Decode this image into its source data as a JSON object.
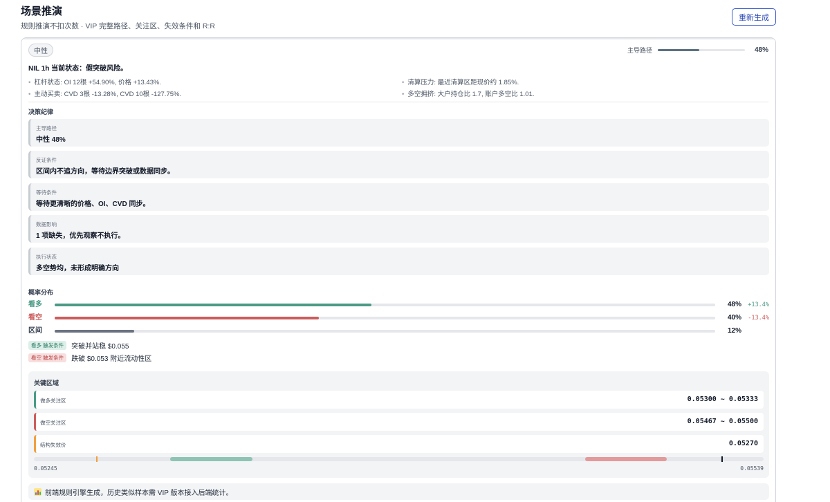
{
  "header": {
    "title": "场景推演",
    "subtitle": "规则推演不扣次数 · VIP 完整路径、关注区、失效条件和 R:R",
    "regenerate_label": "重新生成"
  },
  "summary": {
    "stance": "中性",
    "main_path_label": "主导路径",
    "main_path_pct": "48%",
    "main_path_value": 0.48,
    "status": "NIL 1h 当前状态：假突破风险。",
    "metrics": [
      "杠杆状态: OI 12根 +54.90%, 价格 +13.43%.",
      "清算压力: 最近清算区距现价约 1.85%.",
      "主动买卖: CVD 3根 -13.28%, CVD 10根 -127.75%.",
      "多空拥挤: 大户持仓比 1.7, 账户多空比 1.01."
    ]
  },
  "discipline": {
    "title": "决策纪律",
    "items": [
      {
        "label": "主导路径",
        "value": "中性 48%"
      },
      {
        "label": "反证条件",
        "value": "区间内不追方向，等待边界突破或数据同步。"
      },
      {
        "label": "等待条件",
        "value": "等待更清晰的价格、OI、CVD 同步。"
      },
      {
        "label": "数据影响",
        "value": "1 项缺失，优先观察不执行。"
      },
      {
        "label": "执行状态",
        "value": "多空势均，未形成明确方向"
      }
    ]
  },
  "probability": {
    "title": "概率分布",
    "rows": [
      {
        "label": "看多",
        "pct": "48%",
        "value": 0.48,
        "change": "+13.4%",
        "color": "#4a9a84"
      },
      {
        "label": "看空",
        "pct": "40%",
        "value": 0.4,
        "change": "-13.4%",
        "color": "#cc5c5c"
      },
      {
        "label": "区间",
        "pct": "12%",
        "value": 0.12,
        "change": "",
        "color": "#6b7280"
      }
    ],
    "triggers": [
      {
        "tag": "看多 触发条件",
        "text": "突破并站稳 $0.055"
      },
      {
        "tag": "看空 触发条件",
        "text": "跌破 $0.053 附近流动性区"
      }
    ]
  },
  "zones": {
    "title": "关键区域",
    "items": [
      {
        "label": "做多关注区",
        "value": "0.05300 ~ 0.05333",
        "color": "#4a9a84"
      },
      {
        "label": "做空关注区",
        "value": "0.05467 ~ 0.05500",
        "color": "#cc5c5c"
      },
      {
        "label": "结构失效价",
        "value": "0.05270",
        "color": "#f0a040"
      }
    ],
    "range_min": "0.05245",
    "range_max": "0.05539",
    "range": {
      "min": 0.05245,
      "max": 0.05539,
      "long_zone": [
        0.053,
        0.05333
      ],
      "short_zone": [
        0.05467,
        0.055
      ],
      "invalidation": 0.0527,
      "current": 0.05522
    }
  },
  "footnote": "前端规则引擎生成，历史类似样本需 VIP 版本接入后端统计。",
  "colors": {
    "accent": "#3b5bcc",
    "bull": "#4a9a84",
    "bear": "#cc5c5c",
    "neutral": "#6b7280",
    "invalidation": "#f0a040"
  }
}
